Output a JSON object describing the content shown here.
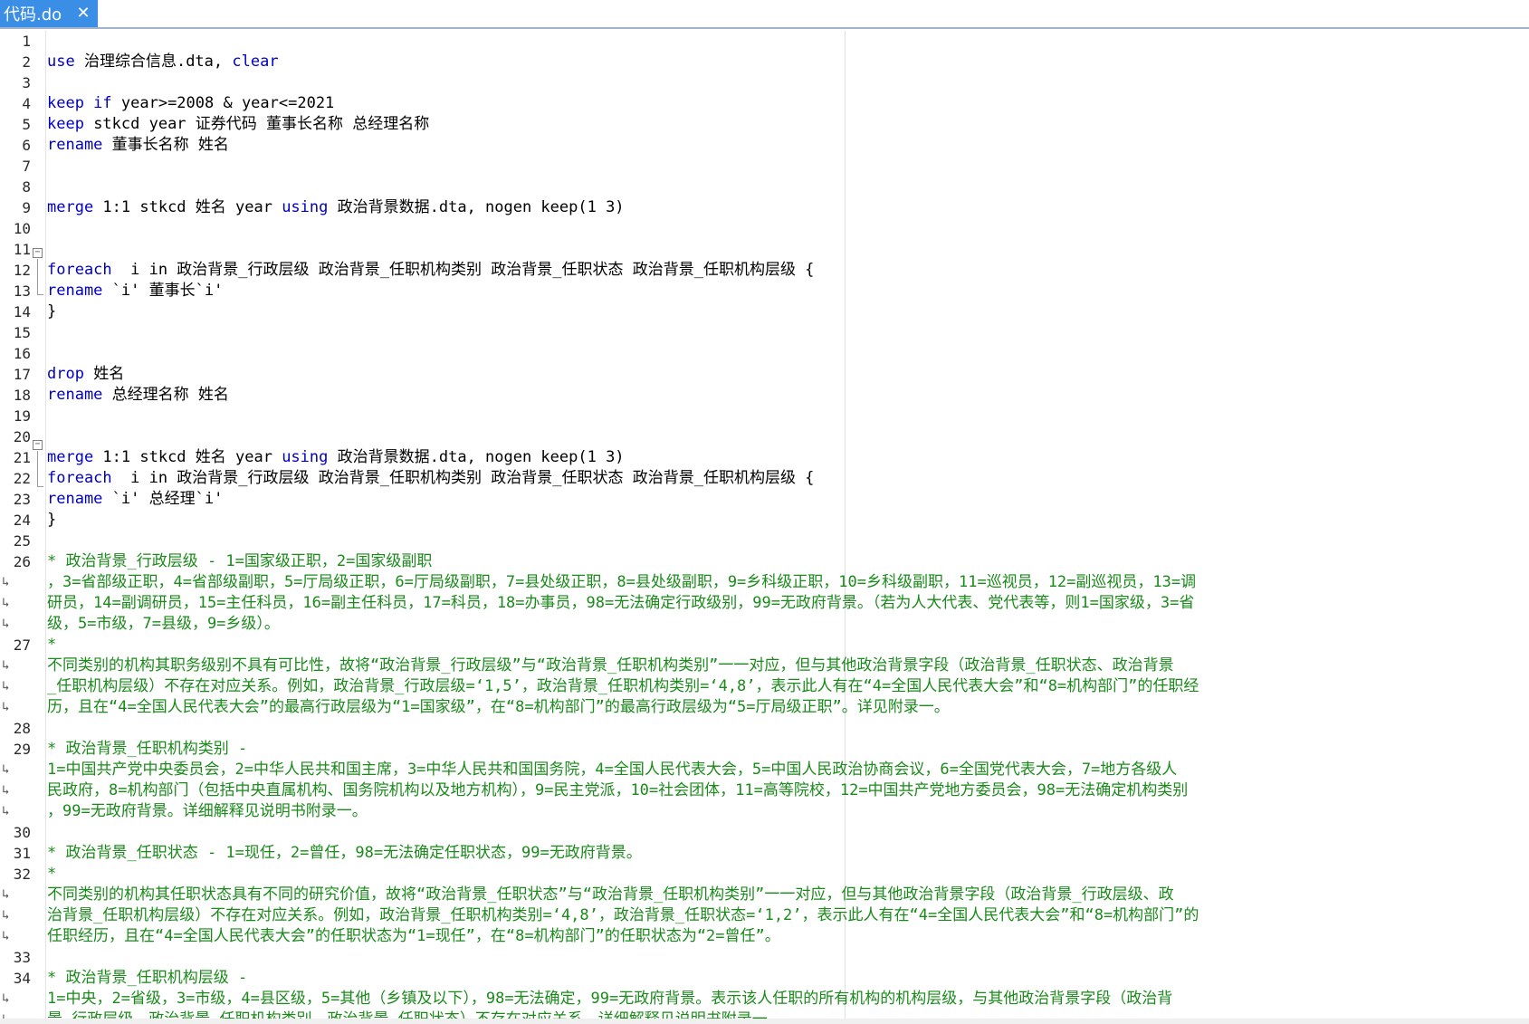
{
  "tab": {
    "title": "代码.do"
  },
  "line_numbers": [
    "1",
    "2",
    "3",
    "4",
    "5",
    "6",
    "7",
    "8",
    "9",
    "10",
    "11",
    "12",
    "13",
    "14",
    "15",
    "16",
    "17",
    "18",
    "19",
    "20",
    "21",
    "22",
    "23",
    "24",
    "25",
    "26",
    "",
    "",
    "",
    "27",
    "",
    "",
    "",
    "28",
    "29",
    "",
    "",
    "",
    "30",
    "31",
    "32",
    "",
    "",
    "",
    "33",
    "34",
    "",
    ""
  ],
  "code_lines": [
    [],
    [
      {
        "c": "kw",
        "t": "use"
      },
      {
        "c": "",
        "t": " 治理综合信息.dta, "
      },
      {
        "c": "kw",
        "t": "clear"
      }
    ],
    [],
    [
      {
        "c": "kw",
        "t": "keep if"
      },
      {
        "c": "",
        "t": " year>=2008 & year<=2021"
      }
    ],
    [
      {
        "c": "kw",
        "t": "keep"
      },
      {
        "c": "",
        "t": " stkcd year 证券代码 董事长名称 总经理名称"
      }
    ],
    [
      {
        "c": "kw",
        "t": "rename"
      },
      {
        "c": "",
        "t": " 董事长名称 姓名"
      }
    ],
    [],
    [],
    [
      {
        "c": "kw",
        "t": "merge"
      },
      {
        "c": "",
        "t": " 1:1 stkcd 姓名 year "
      },
      {
        "c": "kw",
        "t": "using"
      },
      {
        "c": "",
        "t": " 政治背景数据.dta, nogen keep(1 3)"
      }
    ],
    [],
    [],
    [
      {
        "c": "kw",
        "t": "foreach"
      },
      {
        "c": "",
        "t": "  i in 政治背景_行政层级 政治背景_任职机构类别 政治背景_任职状态 政治背景_任职机构层级 {"
      }
    ],
    [
      {
        "c": "kw",
        "t": "rename"
      },
      {
        "c": "",
        "t": " `i' 董事长`i'"
      }
    ],
    [
      {
        "c": "",
        "t": "}"
      }
    ],
    [],
    [],
    [
      {
        "c": "kw",
        "t": "drop"
      },
      {
        "c": "",
        "t": " 姓名"
      }
    ],
    [
      {
        "c": "kw",
        "t": "rename"
      },
      {
        "c": "",
        "t": " 总经理名称 姓名"
      }
    ],
    [],
    [],
    [
      {
        "c": "kw",
        "t": "merge"
      },
      {
        "c": "",
        "t": " 1:1 stkcd 姓名 year "
      },
      {
        "c": "kw",
        "t": "using"
      },
      {
        "c": "",
        "t": " 政治背景数据.dta, nogen keep(1 3)"
      }
    ],
    [
      {
        "c": "kw",
        "t": "foreach"
      },
      {
        "c": "",
        "t": "  i in 政治背景_行政层级 政治背景_任职机构类别 政治背景_任职状态 政治背景_任职机构层级 {"
      }
    ],
    [
      {
        "c": "kw",
        "t": "rename"
      },
      {
        "c": "",
        "t": " `i' 总经理`i'"
      }
    ],
    [
      {
        "c": "",
        "t": "}"
      }
    ],
    [],
    [
      {
        "c": "cm",
        "t": "* 政治背景_行政层级 - 1=国家级正职，2=国家级副职"
      }
    ],
    [
      {
        "c": "cm",
        "t": "，3=省部级正职，4=省部级副职，5=厅局级正职，6=厅局级副职，7=县处级正职，8=县处级副职，9=乡科级正职，10=乡科级副职，11=巡视员，12=副巡视员，13=调"
      }
    ],
    [
      {
        "c": "cm",
        "t": "研员，14=副调研员，15=主任科员，16=副主任科员，17=科员，18=办事员，98=无法确定行政级别，99=无政府背景。（若为人大代表、党代表等，则1=国家级，3=省"
      }
    ],
    [
      {
        "c": "cm",
        "t": "级，5=市级，7=县级，9=乡级）。"
      }
    ],
    [
      {
        "c": "cm",
        "t": "*"
      }
    ],
    [
      {
        "c": "cm",
        "t": "不同类别的机构其职务级别不具有可比性，故将“政治背景_行政层级”与“政治背景_任职机构类别”一一对应，但与其他政治背景字段（政治背景_任职状态、政治背景"
      }
    ],
    [
      {
        "c": "cm",
        "t": "_任职机构层级）不存在对应关系。例如，政治背景_行政层级=‘1,5’，政治背景_任职机构类别=‘4,8’，表示此人有在“4=全国人民代表大会”和“8=机构部门”的任职经"
      }
    ],
    [
      {
        "c": "cm",
        "t": "历，且在“4=全国人民代表大会”的最高行政层级为“1=国家级”，在“8=机构部门”的最高行政层级为“5=厅局级正职”。详见附录一。"
      }
    ],
    [],
    [
      {
        "c": "cm",
        "t": "* 政治背景_任职机构类别 -"
      }
    ],
    [
      {
        "c": "cm",
        "t": "1=中国共产党中央委员会，2=中华人民共和国主席，3=中华人民共和国国务院，4=全国人民代表大会，5=中国人民政治协商会议，6=全国党代表大会，7=地方各级人"
      }
    ],
    [
      {
        "c": "cm",
        "t": "民政府，8=机构部门（包括中央直属机构、国务院机构以及地方机构），9=民主党派，10=社会团体，11=高等院校，12=中国共产党地方委员会，98=无法确定机构类别"
      }
    ],
    [
      {
        "c": "cm",
        "t": "，99=无政府背景。详细解释见说明书附录一。"
      }
    ],
    [],
    [
      {
        "c": "cm",
        "t": "* 政治背景_任职状态 - 1=现任，2=曾任，98=无法确定任职状态，99=无政府背景。"
      }
    ],
    [
      {
        "c": "cm",
        "t": "*"
      }
    ],
    [
      {
        "c": "cm",
        "t": "不同类别的机构其任职状态具有不同的研究价值，故将“政治背景_任职状态”与“政治背景_任职机构类别”一一对应，但与其他政治背景字段（政治背景_行政层级、政"
      }
    ],
    [
      {
        "c": "cm",
        "t": "治背景_任职机构层级）不存在对应关系。例如，政治背景_任职机构类别=‘4,8’，政治背景_任职状态=‘1,2’，表示此人有在“4=全国人民代表大会”和“8=机构部门”的"
      }
    ],
    [
      {
        "c": "cm",
        "t": "任职经历，且在“4=全国人民代表大会”的任职状态为“1=现任”，在“8=机构部门”的任职状态为“2=曾任”。"
      }
    ],
    [],
    [
      {
        "c": "cm",
        "t": "* 政治背景_任职机构层级 -"
      }
    ],
    [
      {
        "c": "cm",
        "t": "1=中央，2=省级，3=市级，4=县区级，5=其他（乡镇及以下），98=无法确定，99=无政府背景。表示该人任职的所有机构的机构层级，与其他政治背景字段（政治背"
      }
    ],
    [
      {
        "c": "cm",
        "t": "景_行政层级、政治背景_任职机构类别、政治背景_任职状态）不存在对应关系。详细解释见说明书附录一。"
      }
    ]
  ]
}
